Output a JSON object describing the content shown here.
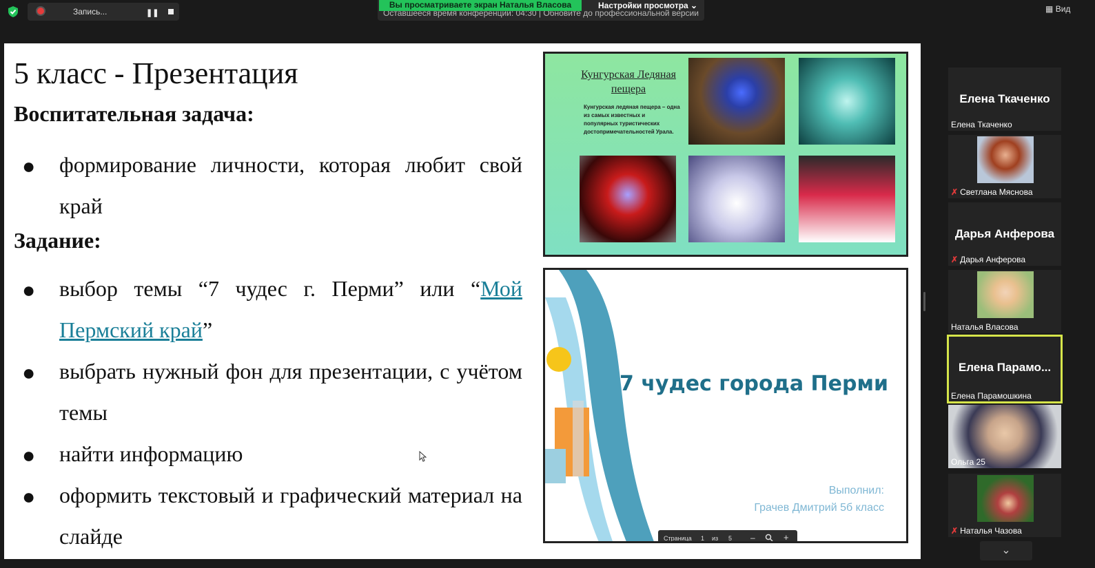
{
  "toolbar": {
    "recording_label": "Запись...",
    "pause_glyph": "❚❚",
    "sharing_notice": "Вы просматриваете экран Наталья Власова",
    "view_options": "Настройки просмотра ⌄",
    "time_notice": "Оставшееся время конференции: 04:30 | Обновите до профессиональной версии",
    "view_button": "Вид",
    "view_icon": "▦"
  },
  "slide": {
    "title": "5 класс - Презентация",
    "heading1": "Воспитательная задача:",
    "bullet_glyph": "●",
    "goal1": "формирование личности, которая любит свой край",
    "heading2": "Задание:",
    "task1_a": "выбор темы “7 чудес г. Перми” или “",
    "task1_link": "Мой Пермский край",
    "task1_b": "”",
    "task2": "выбрать нужный фон для презентации, с учётом темы",
    "task3": "найти информацию",
    "task4": "оформить текстовый и графический материал на слайде"
  },
  "thumb1": {
    "caption_title": "Кунгурская Ледяная пещера",
    "caption_text": "Кунгурская ледяная пещера – одна из самых известных и популярных туристических достопримечательностей Урала."
  },
  "thumb2": {
    "title": "7 чудес города Перми",
    "author1": "Выполнил:",
    "author2": "Грачев Дмитрий 5б класс",
    "pager": {
      "page_label": "Страница",
      "current": "1",
      "of": "из",
      "total": "5",
      "minus": "–",
      "plus": "+"
    }
  },
  "participants": [
    {
      "big": "Елена Ткаченко",
      "name": "Елена Ткаченко",
      "muted": false
    },
    {
      "big": "",
      "name": "Светлана Мяснова",
      "muted": true
    },
    {
      "big": "Дарья Анферова",
      "name": "Дарья Анферова",
      "muted": true
    },
    {
      "big": "",
      "name": "Наталья Власова",
      "muted": false
    },
    {
      "big": "Елена Парамо...",
      "name": "Елена Парамошкина",
      "muted": false
    },
    {
      "big": "",
      "name": "Ольга 25",
      "muted": false
    },
    {
      "big": "",
      "name": "Наталья Чазова",
      "muted": true
    }
  ],
  "scroll_down": "⌄",
  "colors": {
    "green_banner": "#23c35a",
    "active_speaker": "#d6e54a",
    "link": "#1a7f98",
    "mute": "#e03a3a"
  }
}
